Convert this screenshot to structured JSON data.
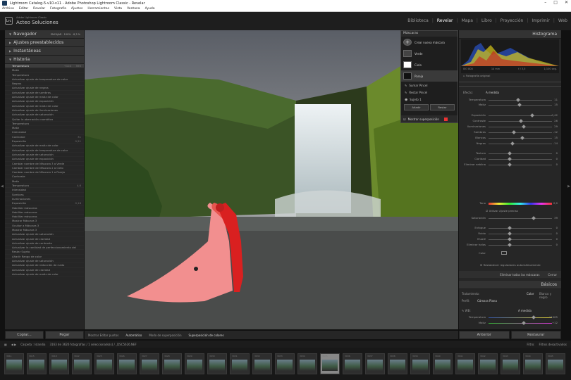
{
  "window": {
    "title": "Lightroom Catalog-5-v10-v11 - Adobe Photoshop Lightroom Classic - Revelar",
    "controls": [
      "–",
      "□",
      "✕"
    ]
  },
  "menu": [
    "Archivo",
    "Editar",
    "Revelar",
    "Fotografía",
    "Ajustes",
    "Herramientas",
    "Vista",
    "Ventana",
    "Ayuda"
  ],
  "identity": {
    "logo": "Lrc",
    "small": "Adobe Lightroom Classic",
    "name": "Acteo Soluciones"
  },
  "modules": [
    "Biblioteca",
    "Revelar",
    "Mapa",
    "Libro",
    "Proyección",
    "Imprimir",
    "Web"
  ],
  "active_module": "Revelar",
  "left": {
    "navigator": {
      "label": "Navegador",
      "fit": "ENCAJAR",
      "pct1": "100%",
      "pct2": "8,3 %"
    },
    "presets": "Ajustes preestablecidos",
    "snapshots": "Instantáneas",
    "history": "Historia",
    "history_items": [
      {
        "t": "Temperatura",
        "a": "+104",
        "b": "595"
      },
      {
        "t": "Matiz",
        "a": "",
        "b": ""
      },
      {
        "t": "Temperatura",
        "a": "",
        "b": ""
      },
      {
        "t": "Actualizar ajuste de temperatura de color",
        "a": "",
        "b": ""
      },
      {
        "t": "Negros",
        "a": "",
        "b": ""
      },
      {
        "t": "Actualizar ajuste de negros",
        "a": "",
        "b": ""
      },
      {
        "t": "Actualizar ajuste de sombras",
        "a": "",
        "b": ""
      },
      {
        "t": "Actualizar ajuste de matiz de color",
        "a": "",
        "b": ""
      },
      {
        "t": "Actualizar ajuste de exposición",
        "a": "",
        "b": ""
      },
      {
        "t": "Actualizar ajuste de matiz de color",
        "a": "",
        "b": ""
      },
      {
        "t": "Actualizar ajuste de iluminaciones",
        "a": "",
        "b": ""
      },
      {
        "t": "Actualizar ajuste de saturación",
        "a": "",
        "b": ""
      },
      {
        "t": "Quitar la aberración cromática",
        "a": "",
        "b": ""
      },
      {
        "t": "Temperatura",
        "a": "",
        "b": ""
      },
      {
        "t": "Matiz",
        "a": "",
        "b": ""
      },
      {
        "t": "Intensidad",
        "a": "",
        "b": ""
      },
      {
        "t": "Contraste",
        "a": "",
        "b": "31"
      },
      {
        "t": "Exposición",
        "a": "",
        "b": "0,51"
      },
      {
        "t": "Actualizar ajuste de matiz de color",
        "a": "",
        "b": ""
      },
      {
        "t": "Actualizar ajuste de temperatura de color",
        "a": "",
        "b": ""
      },
      {
        "t": "Actualizar ajuste de saturación",
        "a": "",
        "b": ""
      },
      {
        "t": "Actualizar ajuste de exposición",
        "a": "",
        "b": ""
      },
      {
        "t": "Cambiar nombre de Máscara 3 a Verde",
        "a": "",
        "b": ""
      },
      {
        "t": "Cambiar nombre de Máscara 2 a Cielo",
        "a": "",
        "b": ""
      },
      {
        "t": "Cambiar nombre de Máscara 1 a Pareja",
        "a": "",
        "b": ""
      },
      {
        "t": "Contraste",
        "a": "",
        "b": ""
      },
      {
        "t": "Matiz",
        "a": "",
        "b": ""
      },
      {
        "t": "Temperatura",
        "a": "",
        "b": "4,6"
      },
      {
        "t": "Intensidad",
        "a": "",
        "b": ""
      },
      {
        "t": "Sombras",
        "a": "",
        "b": ""
      },
      {
        "t": "Iluminaciones",
        "a": "",
        "b": ""
      },
      {
        "t": "Exposición",
        "a": "",
        "b": "0,16"
      },
      {
        "t": "Habilitar máscaras",
        "a": "",
        "b": ""
      },
      {
        "t": "Habilitar máscaras",
        "a": "",
        "b": ""
      },
      {
        "t": "Habilitar máscaras",
        "a": "",
        "b": ""
      },
      {
        "t": "Mostrar Máscara 3",
        "a": "",
        "b": ""
      },
      {
        "t": "Ocultar a Máscara 3",
        "a": "",
        "b": ""
      },
      {
        "t": "Mostrar Máscara 3",
        "a": "",
        "b": ""
      },
      {
        "t": "Actualizar ajuste de saturación",
        "a": "",
        "b": ""
      },
      {
        "t": "Actualizar ajuste de claridad",
        "a": "",
        "b": ""
      },
      {
        "t": "Actualizar ajuste de contraste",
        "a": "",
        "b": ""
      },
      {
        "t": "Actualizar la cantidad de perfeccionamiento del",
        "a": "",
        "b": ""
      },
      {
        "t": "Restar Sujeto",
        "a": "",
        "b": ""
      },
      {
        "t": "Añadir Rango de color",
        "a": "",
        "b": ""
      },
      {
        "t": "Actualizar ajuste de saturación",
        "a": "",
        "b": ""
      },
      {
        "t": "Actualizar ajuste de reducción de ruido",
        "a": "",
        "b": ""
      },
      {
        "t": "Actualizar ajuste de claridad",
        "a": "",
        "b": ""
      },
      {
        "t": "Actualizar ajuste de matiz de color",
        "a": "",
        "b": ""
      }
    ],
    "copy": "Copiar...",
    "paste": "Pegar"
  },
  "toolbar": {
    "a": "Mostrar Editar puntos",
    "b": "Automático",
    "c": "Modo de superposición",
    "d": "Superposición de colores"
  },
  "masks": {
    "title": "Máscaras",
    "create": "Crear nueva máscara",
    "items": [
      "Verde",
      "Cielo",
      "Pareja"
    ],
    "selected": "Pareja",
    "subs": [
      "Sumar Pincel",
      "Restar Pincel",
      "Sujeto 1"
    ],
    "add": "Añadir",
    "sub": "Restar",
    "overlay": "Mostrar superposición"
  },
  "right": {
    "histogram": "Histograma",
    "hist_info": [
      "ISO 800",
      "14 mm",
      "f / 3,5",
      "1/100 seg."
    ],
    "original": "Fotografía original",
    "effect_label": "Efecto:",
    "effect_mode": "A medida",
    "sliders": [
      {
        "l": "Temperatura",
        "v": "11"
      },
      {
        "l": "Matiz",
        "v": "15"
      },
      {
        "l": "Exposición",
        "v": "0,42"
      },
      {
        "l": "Contraste",
        "v": "26"
      },
      {
        "l": "Iluminaciones",
        "v": "29"
      },
      {
        "l": "Sombras",
        "v": "-12"
      },
      {
        "l": "Blancos",
        "v": "15"
      },
      {
        "l": "Negros",
        "v": "-14"
      },
      {
        "l": "Textura",
        "v": "0"
      },
      {
        "l": "Claridad",
        "v": "0"
      },
      {
        "l": "Eliminar neblina",
        "v": "0"
      }
    ],
    "tono": "Tono",
    "tono_v": "0,0",
    "fine": "Utilizar Ajuste preciso",
    "saturacion": "Saturación",
    "saturacion_v": "39",
    "sliders2": [
      {
        "l": "Enfoque",
        "v": "0"
      },
      {
        "l": "Ruido",
        "v": "0"
      },
      {
        "l": "Muaré",
        "v": "0"
      },
      {
        "l": "Eliminar halos",
        "v": "0"
      }
    ],
    "color": "Color",
    "reset_auto": "Restablecer reguladores automáticamente",
    "delete_masks": "Eliminar todas las máscaras",
    "close": "Cerrar",
    "basic": "Básicos",
    "treatment": "Tratamiento:",
    "color_opt": "Color",
    "bw_opt": "Blanco y negro",
    "profile": "Perfil:",
    "profile_v": "Cámara Plana",
    "wb": "WB:",
    "wb_v": "A medida",
    "temp": "Temperatura",
    "temp_v": "11065",
    "tint": "Matiz",
    "tint_v": "+12",
    "tone": "Tono",
    "auto": "Automático",
    "exposure": "Exposición",
    "exposure_v": "+ 0,53",
    "contrast": "Contraste",
    "contrast_v": "+ 37",
    "highlights": "Iluminaciones",
    "highlights_v": "- 34",
    "prev": "Anterior",
    "reset": "Restaurar"
  },
  "filmhead": {
    "a": "Carpeta : Islandia",
    "b": "3163 de 3626 fotografías / 1 seleccionado(s) / _DSC5626.NEF",
    "filter": "Filtro:",
    "filter_v": "Filtros desactivados"
  },
  "film_numbers": [
    "3911",
    "3915",
    "3918",
    "3922",
    "3925",
    "3926",
    "3927",
    "3928",
    "3929",
    "3930",
    "3931",
    "3932",
    "3933",
    "3934",
    "3935",
    "3936",
    "3937",
    "3938",
    "3939",
    "3940",
    "3941",
    "3942",
    "3943",
    "3944",
    "3945"
  ]
}
